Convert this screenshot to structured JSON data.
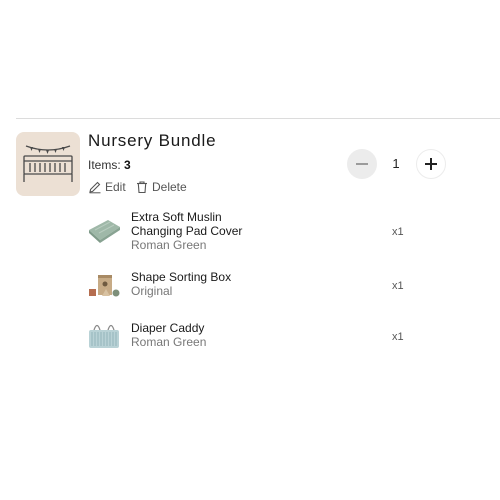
{
  "bundle": {
    "title": "Nursery Bundle",
    "items_label": "Items:",
    "items_count": "3",
    "edit_label": "Edit",
    "delete_label": "Delete",
    "quantity": "1",
    "thumb_icon": "crib-icon"
  },
  "items": [
    {
      "name_line1": "Extra Soft Muslin",
      "name_line2": "Changing Pad Cover",
      "variant": "Roman Green",
      "qty": "x1",
      "icon": "changing-pad-icon"
    },
    {
      "name_line1": "Shape Sorting Box",
      "variant": "Original",
      "qty": "x1",
      "icon": "sorting-box-icon"
    },
    {
      "name_line1": "Diaper Caddy",
      "variant": "Roman Green",
      "qty": "x1",
      "icon": "diaper-caddy-icon"
    }
  ],
  "colors": {
    "thumb_bg": "#ece0d4",
    "minus_bg": "#ececec",
    "divider": "#dcdcdc",
    "product_green": "#9fb8a8"
  }
}
